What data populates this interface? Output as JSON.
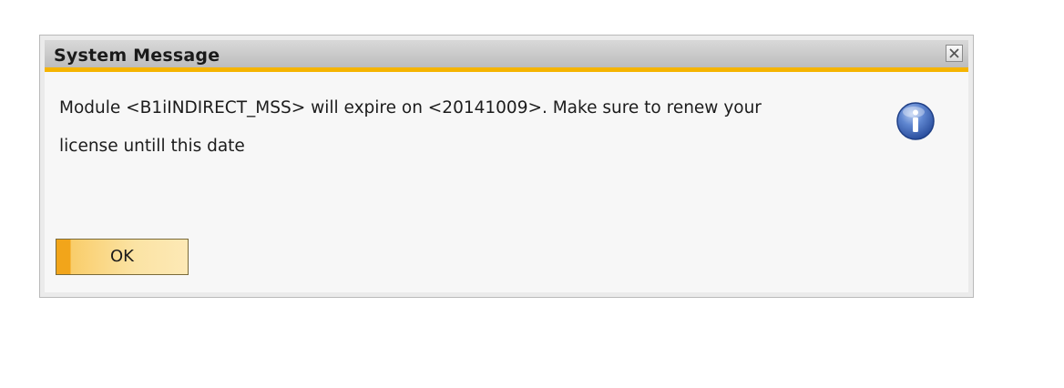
{
  "dialog": {
    "title": "System Message",
    "close_icon": "close-icon",
    "message_line1": "Module <B1iINDIRECT_MSS> will expire on <20141009>. Make sure to renew your",
    "message_line2": "license untill this date",
    "info_icon": "info-icon",
    "ok_label": "OK"
  },
  "colors": {
    "accent": "#f5b400",
    "button_fill": "#fbe3a4",
    "info_blue": "#3a63b8"
  }
}
